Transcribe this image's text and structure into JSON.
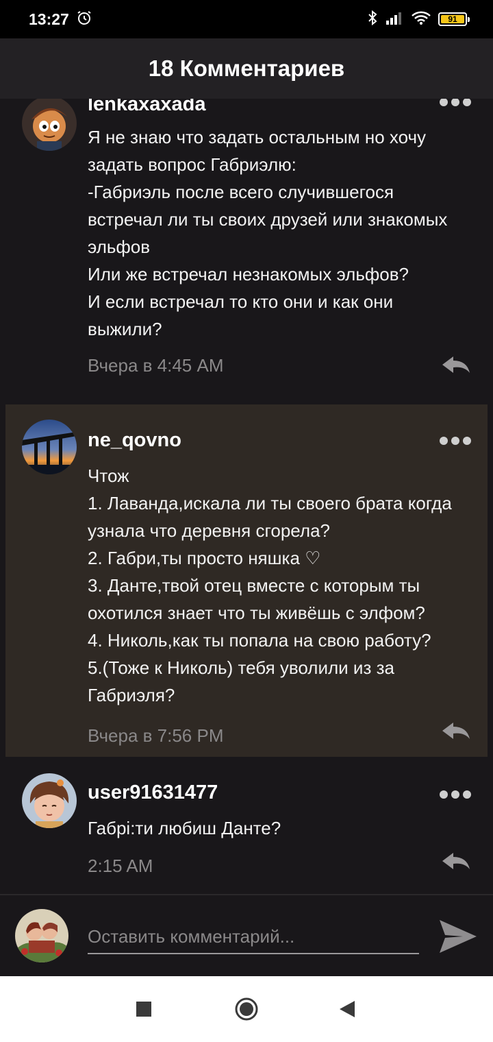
{
  "status_bar": {
    "time": "13:27",
    "battery": "91"
  },
  "header": {
    "title": "18 Комментариев"
  },
  "comments": [
    {
      "username": "lenkaxaxada",
      "text": "Я не знаю что задать остальным но хочу задать вопрос Габриэлю:\n-Габриэль после всего случившегося встречал ли ты своих друзей или знакомых эльфов\nИли же встречал незнакомых эльфов?\nИ если встречал то кто они и как они выжили?",
      "time": "Вчера в 4:45 AM"
    },
    {
      "username": "ne_qovno",
      "text": "Чтож\n1. Лаванда,искала ли ты своего брата когда узнала что деревня сгорела?\n2. Габри,ты просто няшка ♡\n3. Данте,твой отец вместе с которым ты охотился знает что ты живёшь с элфом?\n4. Николь,как ты попала на свою работу?\n5.(Тоже к Николь) тебя уволили из за Габриэля?",
      "time": "Вчера в 7:56 PM"
    },
    {
      "username": "user91631477",
      "text": "Габрі:ти любиш Данте?",
      "time": "2:15 AM"
    }
  ],
  "input": {
    "placeholder": "Оставить комментарий..."
  },
  "colors": {
    "highlight_bg": "#2f2924",
    "background": "#19171a",
    "header_bg": "#232124",
    "muted_text": "#8a8889"
  },
  "icons": [
    "alarm-icon",
    "bluetooth-icon",
    "signal-icon",
    "wifi-icon",
    "battery-icon",
    "more-icon",
    "reply-icon",
    "send-icon",
    "nav-recents-icon",
    "nav-home-icon",
    "nav-back-icon"
  ]
}
